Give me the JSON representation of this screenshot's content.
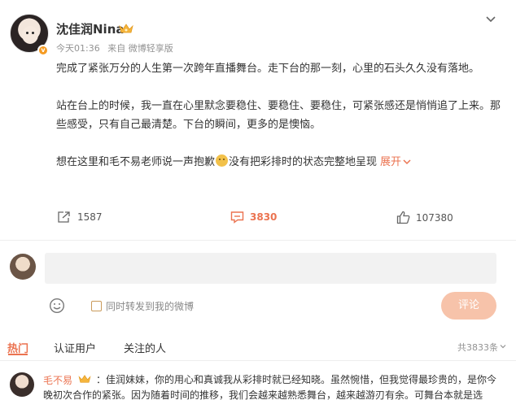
{
  "post": {
    "username": "沈佳润Nina",
    "time": "今天01:36",
    "source": "来自 微博轻享版",
    "paragraphs": [
      "完成了紧张万分的人生第一次跨年直播舞台。走下台的那一刻，心里的石头久久没有落地。",
      "站在台上的时候，我一直在心里默念要稳住、要稳住、要稳住，可紧张感还是悄悄追了上来。那些感受，只有自己最清楚。下台的瞬间，更多的是懊恼。"
    ],
    "last_paragraph_before": "想在这里和毛不易老师说一声抱歉",
    "last_paragraph_after": "没有把彩排时的状态完整地呈现",
    "expand_label": "展开"
  },
  "actions": {
    "repost_count": "1587",
    "comment_count": "3830",
    "like_count": "107380"
  },
  "composer": {
    "repost_option_label": "同时转发到我的微博",
    "submit_label": "评论"
  },
  "comment_tabs": {
    "tabs": [
      "热门",
      "认证用户",
      "关注的人"
    ],
    "total": "共3833条"
  },
  "top_comment": {
    "name": "毛不易",
    "text": "：佳润妹妹，你的用心和真诚我从彩排时就已经知晓。虽然惋惜，但我觉得最珍贵的，是你今晚初次合作的紧张。因为随着时间的推移，我们会越来越熟悉舞台，越来越游刃有余。可舞台本就是选"
  },
  "colors": {
    "accent": "#eb7350",
    "verified_badge": "#f59b23",
    "submit_disabled": "#f7c3aa"
  },
  "icons": [
    "verified-icon",
    "vip-crown-icon",
    "chevron-down-icon",
    "repost-icon",
    "comment-icon",
    "like-icon",
    "emoji-icon"
  ]
}
